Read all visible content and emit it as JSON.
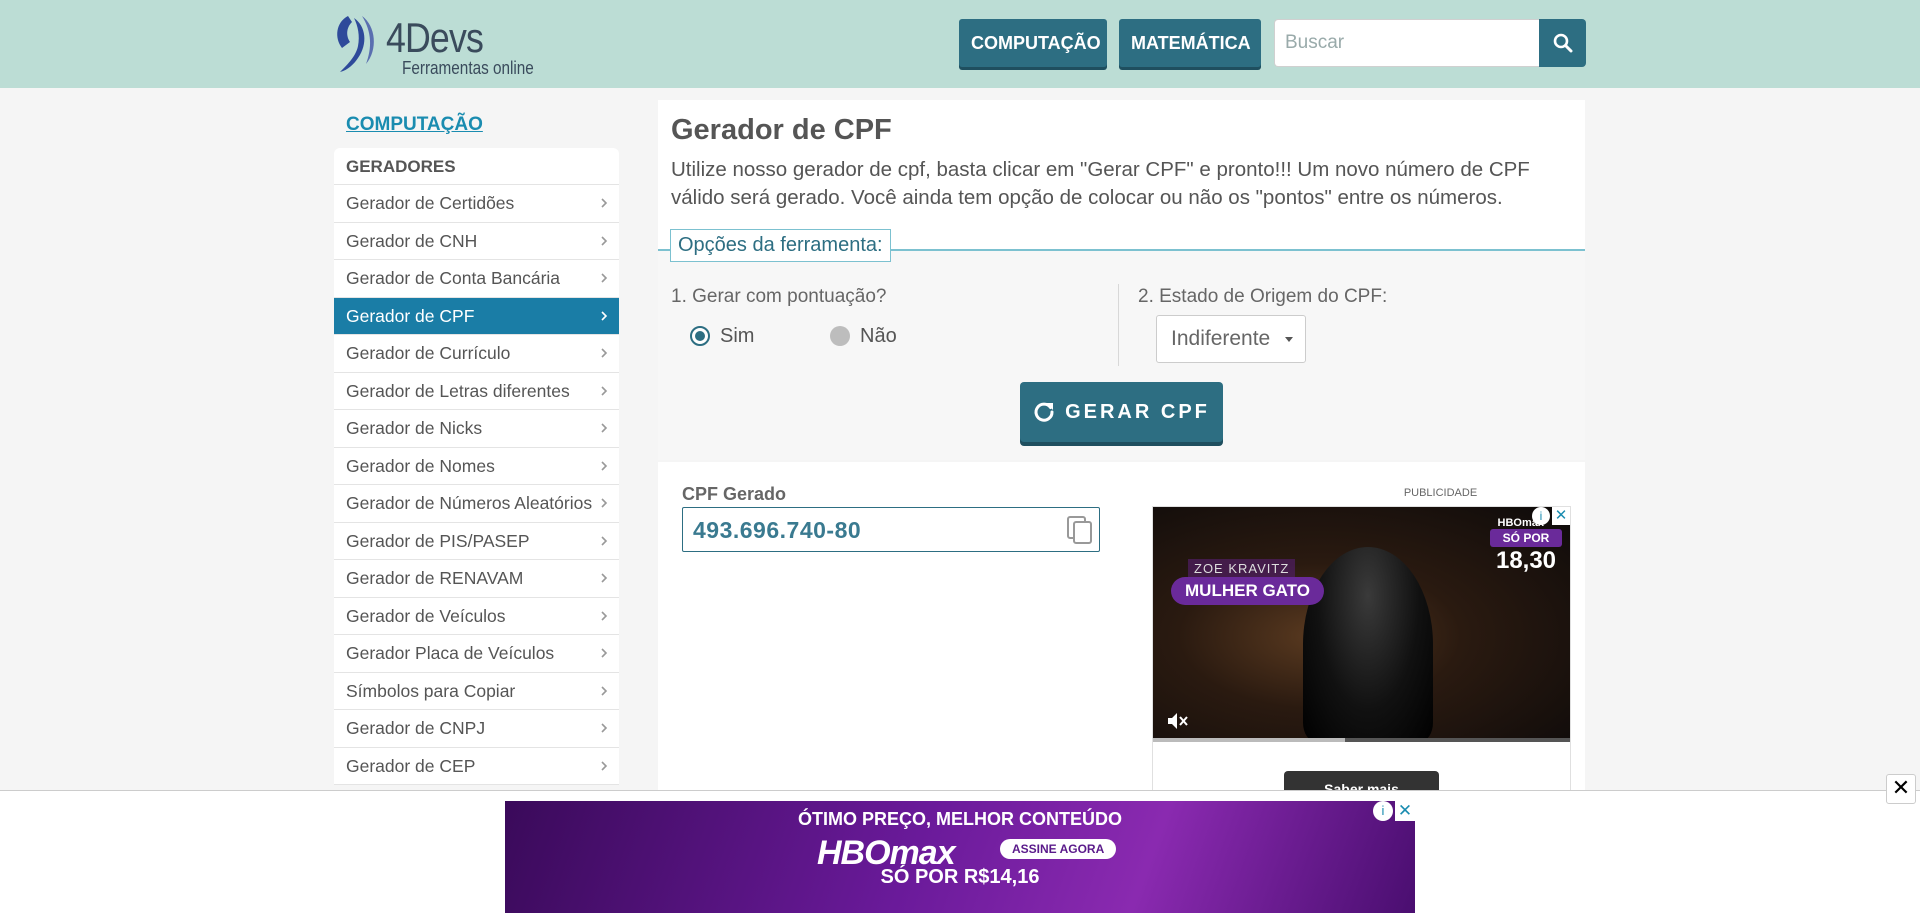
{
  "header": {
    "logo_name": "4Devs",
    "logo_tagline": "Ferramentas online",
    "nav": [
      "COMPUTAÇÃO",
      "MATEMÁTICA"
    ],
    "search_placeholder": "Buscar",
    "colors": {
      "background": "#bcddd5",
      "button": "#2d6e82"
    }
  },
  "sidebar": {
    "title": "COMPUTAÇÃO",
    "section": "GERADORES",
    "items": [
      "Gerador de Certidões",
      "Gerador de CNH",
      "Gerador de Conta Bancária",
      "Gerador de CPF",
      "Gerador de Currículo",
      "Gerador de Letras diferentes",
      "Gerador de Nicks",
      "Gerador de Nomes",
      "Gerador de Números Aleatórios",
      "Gerador de PIS/PASEP",
      "Gerador de RENAVAM",
      "Gerador de Veículos",
      "Gerador Placa de Veículos",
      "Símbolos para Copiar",
      "Gerador de CNPJ",
      "Gerador de CEP"
    ],
    "active_item": "Gerador de CPF",
    "active_color": "#1a7da6"
  },
  "main": {
    "title": "Gerador de CPF",
    "description": "Utilize nosso gerador de cpf, basta clicar em \"Gerar CPF\" e pronto!!! Um novo número de CPF válido será gerado. Você ainda tem opção de colocar ou não os \"pontos\" entre os números.",
    "options_legend": "Opções da ferramenta:",
    "option1_label": "1. Gerar com pontuação?",
    "option1_choices": [
      "Sim",
      "Não"
    ],
    "option1_selected": "Sim",
    "option2_label": "2. Estado de Origem do CPF:",
    "option2_selected": "Indiferente",
    "generate_button": "GERAR CPF",
    "result_label": "CPF Gerado",
    "result_value": "493.696.740-80"
  },
  "ad": {
    "label": "PUBLICIDADE",
    "tag_small": "ZOE KRAVITZ",
    "tag_big": "MULHER GATO",
    "brand": "HBOmax",
    "price_prefix": "SÓ POR",
    "price_value": "18,30",
    "cta": "Saber mais",
    "progress": 0.46
  },
  "bottom_banner": {
    "line1": "ÓTIMO PREÇO, MELHOR CONTEÚDO",
    "logo": "HBOmax",
    "cta": "ASSINE AGORA",
    "line3": "SÓ POR R$14,16"
  }
}
